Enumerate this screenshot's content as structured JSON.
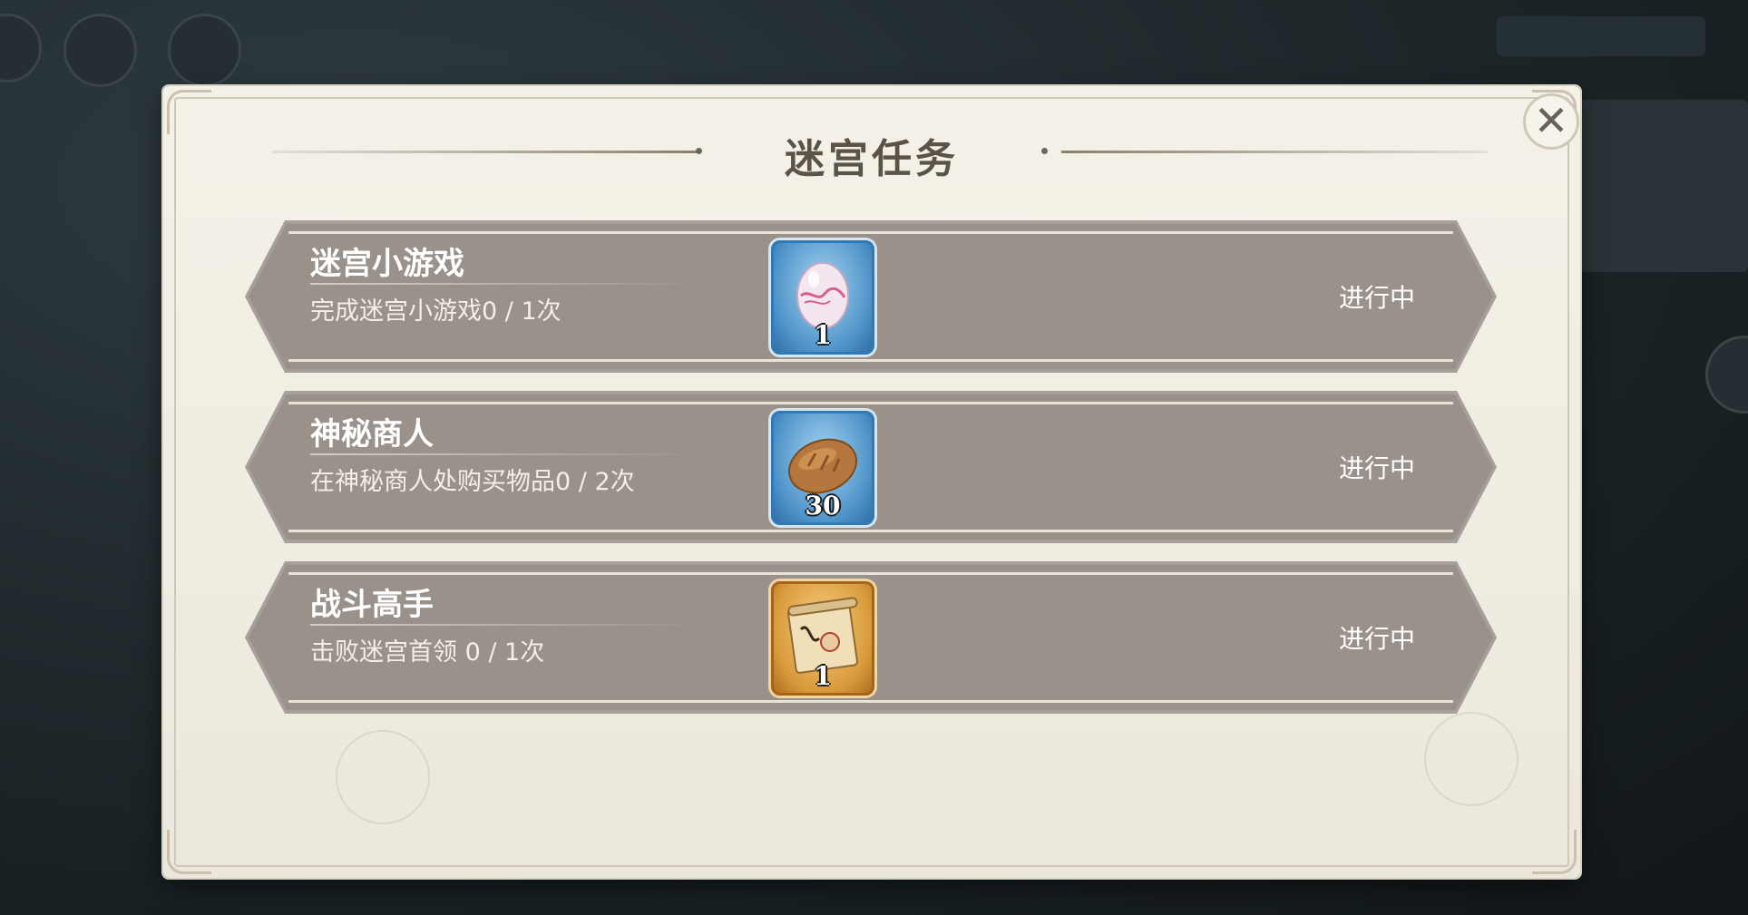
{
  "dialog": {
    "title": "迷宫任务",
    "close_label": "✕"
  },
  "tasks": [
    {
      "name": "迷宫小游戏",
      "description": "完成迷宫小游戏0 / 1次",
      "reward": {
        "icon": "egg-icon",
        "quantity": "1",
        "frame_color": "#4f93c8"
      },
      "status": "进行中"
    },
    {
      "name": "神秘商人",
      "description": "在神秘商人处购买物品0 / 2次",
      "reward": {
        "icon": "bread-icon",
        "quantity": "30",
        "frame_color": "#4f93c8"
      },
      "status": "进行中"
    },
    {
      "name": "战斗高手",
      "description": "击败迷宫首领 0 / 1次",
      "reward": {
        "icon": "scroll-icon",
        "quantity": "1",
        "frame_color": "#d99a3b"
      },
      "status": "进行中"
    }
  ],
  "colors": {
    "panel_bg": "#efece1",
    "row_bg": "#9a928a",
    "title_text": "#5b5248"
  }
}
